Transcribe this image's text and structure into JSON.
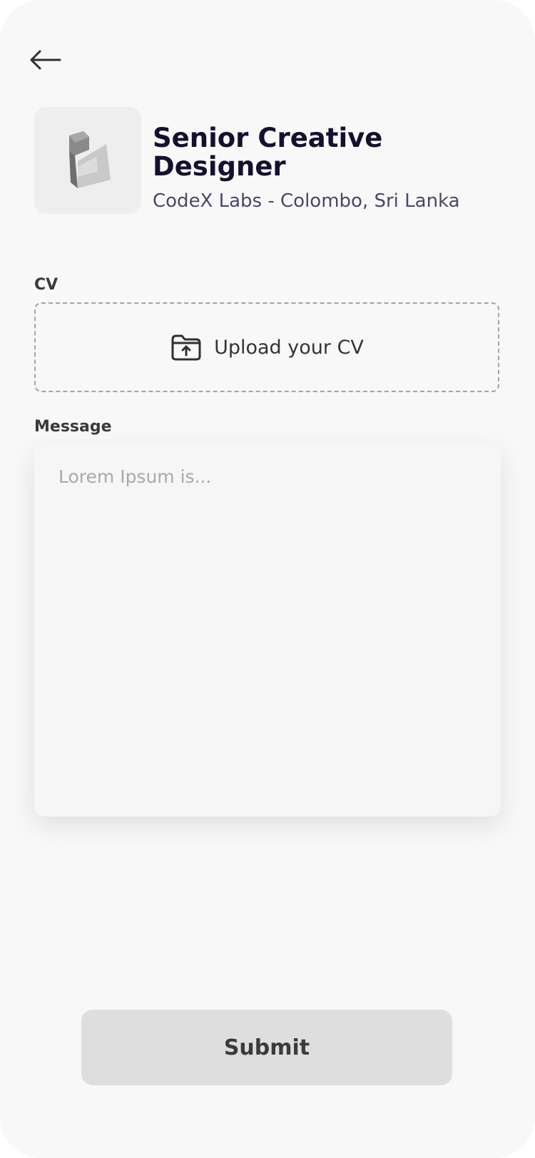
{
  "header": {
    "back_icon": "arrow-left-icon"
  },
  "job": {
    "logo_icon": "company-logo",
    "title": "Senior Creative Designer",
    "company_location": "CodeX Labs - Colombo, Sri Lanka"
  },
  "form": {
    "cv_label": "CV",
    "upload_icon": "folder-upload-icon",
    "upload_text": "Upload your CV",
    "message_label": "Message",
    "message_placeholder": "Lorem Ipsum is...",
    "message_value": ""
  },
  "actions": {
    "submit_label": "Submit"
  },
  "colors": {
    "background": "#f8f8f8",
    "title": "#15102e",
    "subtitle": "#4b4767",
    "button": "#dedede"
  }
}
